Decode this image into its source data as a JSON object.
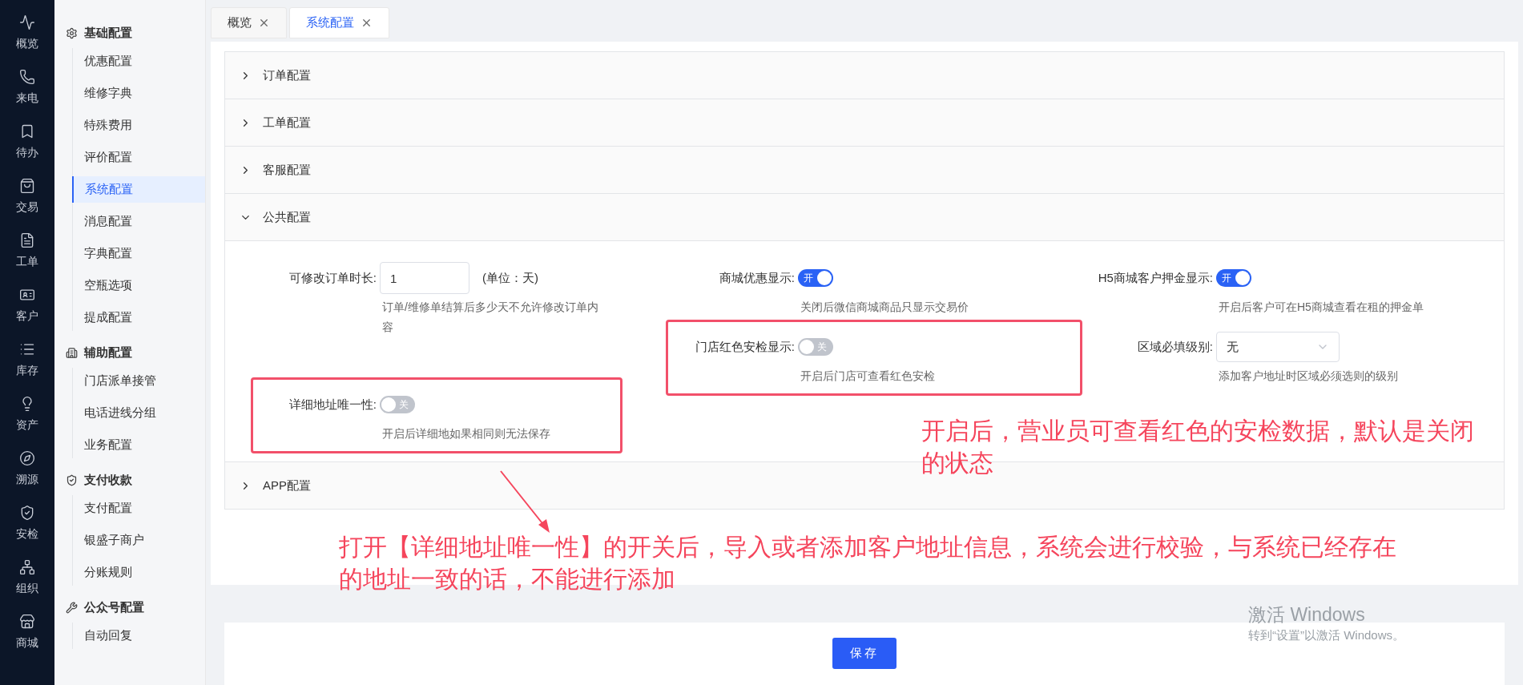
{
  "nav": [
    {
      "label": "概览"
    },
    {
      "label": "来电"
    },
    {
      "label": "待办"
    },
    {
      "label": "交易"
    },
    {
      "label": "工单"
    },
    {
      "label": "客户"
    },
    {
      "label": "库存"
    },
    {
      "label": "资产"
    },
    {
      "label": "溯源"
    },
    {
      "label": "安检"
    },
    {
      "label": "组织"
    },
    {
      "label": "商城"
    }
  ],
  "sidebar": {
    "groups": [
      {
        "title": "基础配置",
        "items": [
          {
            "label": "优惠配置",
            "selected": false
          },
          {
            "label": "维修字典",
            "selected": false
          },
          {
            "label": "特殊费用",
            "selected": false
          },
          {
            "label": "评价配置",
            "selected": false
          },
          {
            "label": "系统配置",
            "selected": true
          },
          {
            "label": "消息配置",
            "selected": false
          },
          {
            "label": "字典配置",
            "selected": false
          },
          {
            "label": "空瓶选项",
            "selected": false
          },
          {
            "label": "提成配置",
            "selected": false
          }
        ]
      },
      {
        "title": "辅助配置",
        "items": [
          {
            "label": "门店派单接管",
            "selected": false
          },
          {
            "label": "电话进线分组",
            "selected": false
          },
          {
            "label": "业务配置",
            "selected": false
          }
        ]
      },
      {
        "title": "支付收款",
        "items": [
          {
            "label": "支付配置",
            "selected": false
          },
          {
            "label": "银盛子商户",
            "selected": false
          },
          {
            "label": "分账规则",
            "selected": false
          }
        ]
      },
      {
        "title": "公众号配置",
        "items": [
          {
            "label": "自动回复",
            "selected": false
          }
        ]
      }
    ]
  },
  "tabs": [
    {
      "label": "概览",
      "selected": false
    },
    {
      "label": "系统配置",
      "selected": true
    }
  ],
  "sections": [
    {
      "title": "订单配置",
      "expanded": false
    },
    {
      "title": "工单配置",
      "expanded": false
    },
    {
      "title": "客服配置",
      "expanded": false
    },
    {
      "title": "公共配置",
      "expanded": true,
      "columns": [
        [
          {
            "kind": "number",
            "label": "可修改订单时长:",
            "value": "1",
            "unit": "(单位：天)",
            "help": "订单/维修单结算后多少天不允许修改订单内容",
            "highlighted": false
          },
          {
            "kind": "switch",
            "label": "详细地址唯一性:",
            "on": false,
            "text": "关",
            "help": "开启后详细地如果相同则无法保存",
            "highlighted": true
          }
        ],
        [
          {
            "kind": "switch",
            "label": "商城优惠显示:",
            "on": true,
            "text": "开",
            "help": "关闭后微信商城商品只显示交易价",
            "highlighted": false
          },
          {
            "kind": "switch",
            "label": "门店红色安检显示:",
            "on": false,
            "text": "关",
            "help": "开启后门店可查看红色安检",
            "highlighted": true
          }
        ],
        [
          {
            "kind": "switch",
            "label": "H5商城客户押金显示:",
            "on": true,
            "text": "开",
            "help": "开启后客户可在H5商城查看在租的押金单",
            "highlighted": false
          },
          {
            "kind": "select",
            "label": "区域必填级别:",
            "value": "无",
            "help": "添加客户地址时区域必须选则的级别",
            "highlighted": false
          }
        ]
      ]
    },
    {
      "title": "APP配置",
      "expanded": false
    }
  ],
  "annotations": [
    {
      "text": "开启后，营业员可查看红色的安检数据，默认是关闭的状态"
    },
    {
      "text": "打开【详细地址唯一性】的开关后，导入或者添加客户地址信息，系统会进行校验，与系统已经存在的地址一致的话，不能进行添加"
    }
  ],
  "save_button": "保存",
  "windows_activation": {
    "title": "激活 Windows",
    "subtitle": "转到“设置”以激活 Windows。"
  }
}
